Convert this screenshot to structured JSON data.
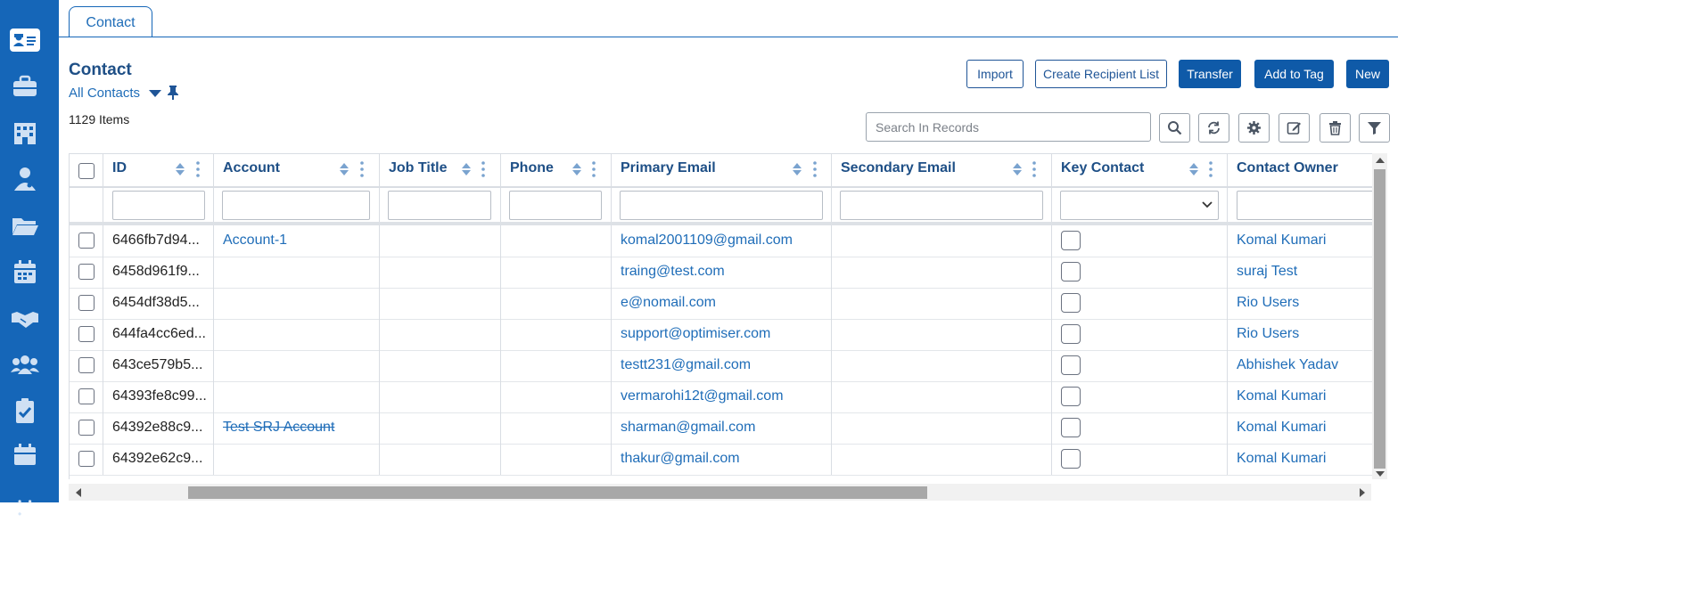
{
  "rail": {
    "icons": [
      "contact-card-icon",
      "briefcase-icon",
      "building-icon",
      "doctor-icon",
      "folder-open-icon",
      "calendar-icon",
      "handshake-icon",
      "users-icon",
      "clipboard-check-icon",
      "calendar-small-icon"
    ]
  },
  "tab": {
    "label": "Contact"
  },
  "page": {
    "title": "Contact",
    "view": "All Contacts",
    "count": "1129 Items"
  },
  "toolbar": {
    "import": "Import",
    "create_recipient_list": "Create Recipient List",
    "transfer": "Transfer",
    "add_to_tag": "Add to Tag",
    "new": "New"
  },
  "search": {
    "placeholder": "Search In Records"
  },
  "table": {
    "headers": {
      "id": "ID",
      "account": "Account",
      "job_title": "Job Title",
      "phone": "Phone",
      "primary_email": "Primary Email",
      "secondary_email": "Secondary Email",
      "key_contact": "Key Contact",
      "contact_owner": "Contact Owner"
    },
    "rows": [
      {
        "id": "6466fb7d94...",
        "account": "Account-1",
        "email": "komal2001109@gmail.com",
        "owner": "Komal Kumari"
      },
      {
        "id": "6458d961f9...",
        "account": "",
        "email": "traing@test.com",
        "owner": "suraj Test"
      },
      {
        "id": "6454df38d5...",
        "account": "",
        "email": "e@nomail.com",
        "owner": "Rio Users"
      },
      {
        "id": "644fa4cc6ed...",
        "account": "",
        "email": "support@optimiser.com",
        "owner": "Rio Users"
      },
      {
        "id": "643ce579b5...",
        "account": "",
        "email": "testt231@gmail.com",
        "owner": "Abhishek Yadav"
      },
      {
        "id": "64393fe8c99...",
        "account": "",
        "email": "vermarohi12t@gmail.com",
        "owner": "Komal Kumari"
      },
      {
        "id": "64392e88c9...",
        "account": "Test SRJ Account",
        "email": "sharman@gmail.com",
        "owner": "Komal Kumari"
      },
      {
        "id": "64392e62c9...",
        "account": "",
        "email": "thakur@gmail.com",
        "owner": "Komal Kumari"
      }
    ]
  },
  "colors": {
    "accent": "#1566b8",
    "primary_button": "#0f5aa8",
    "link": "#1f6db8"
  }
}
